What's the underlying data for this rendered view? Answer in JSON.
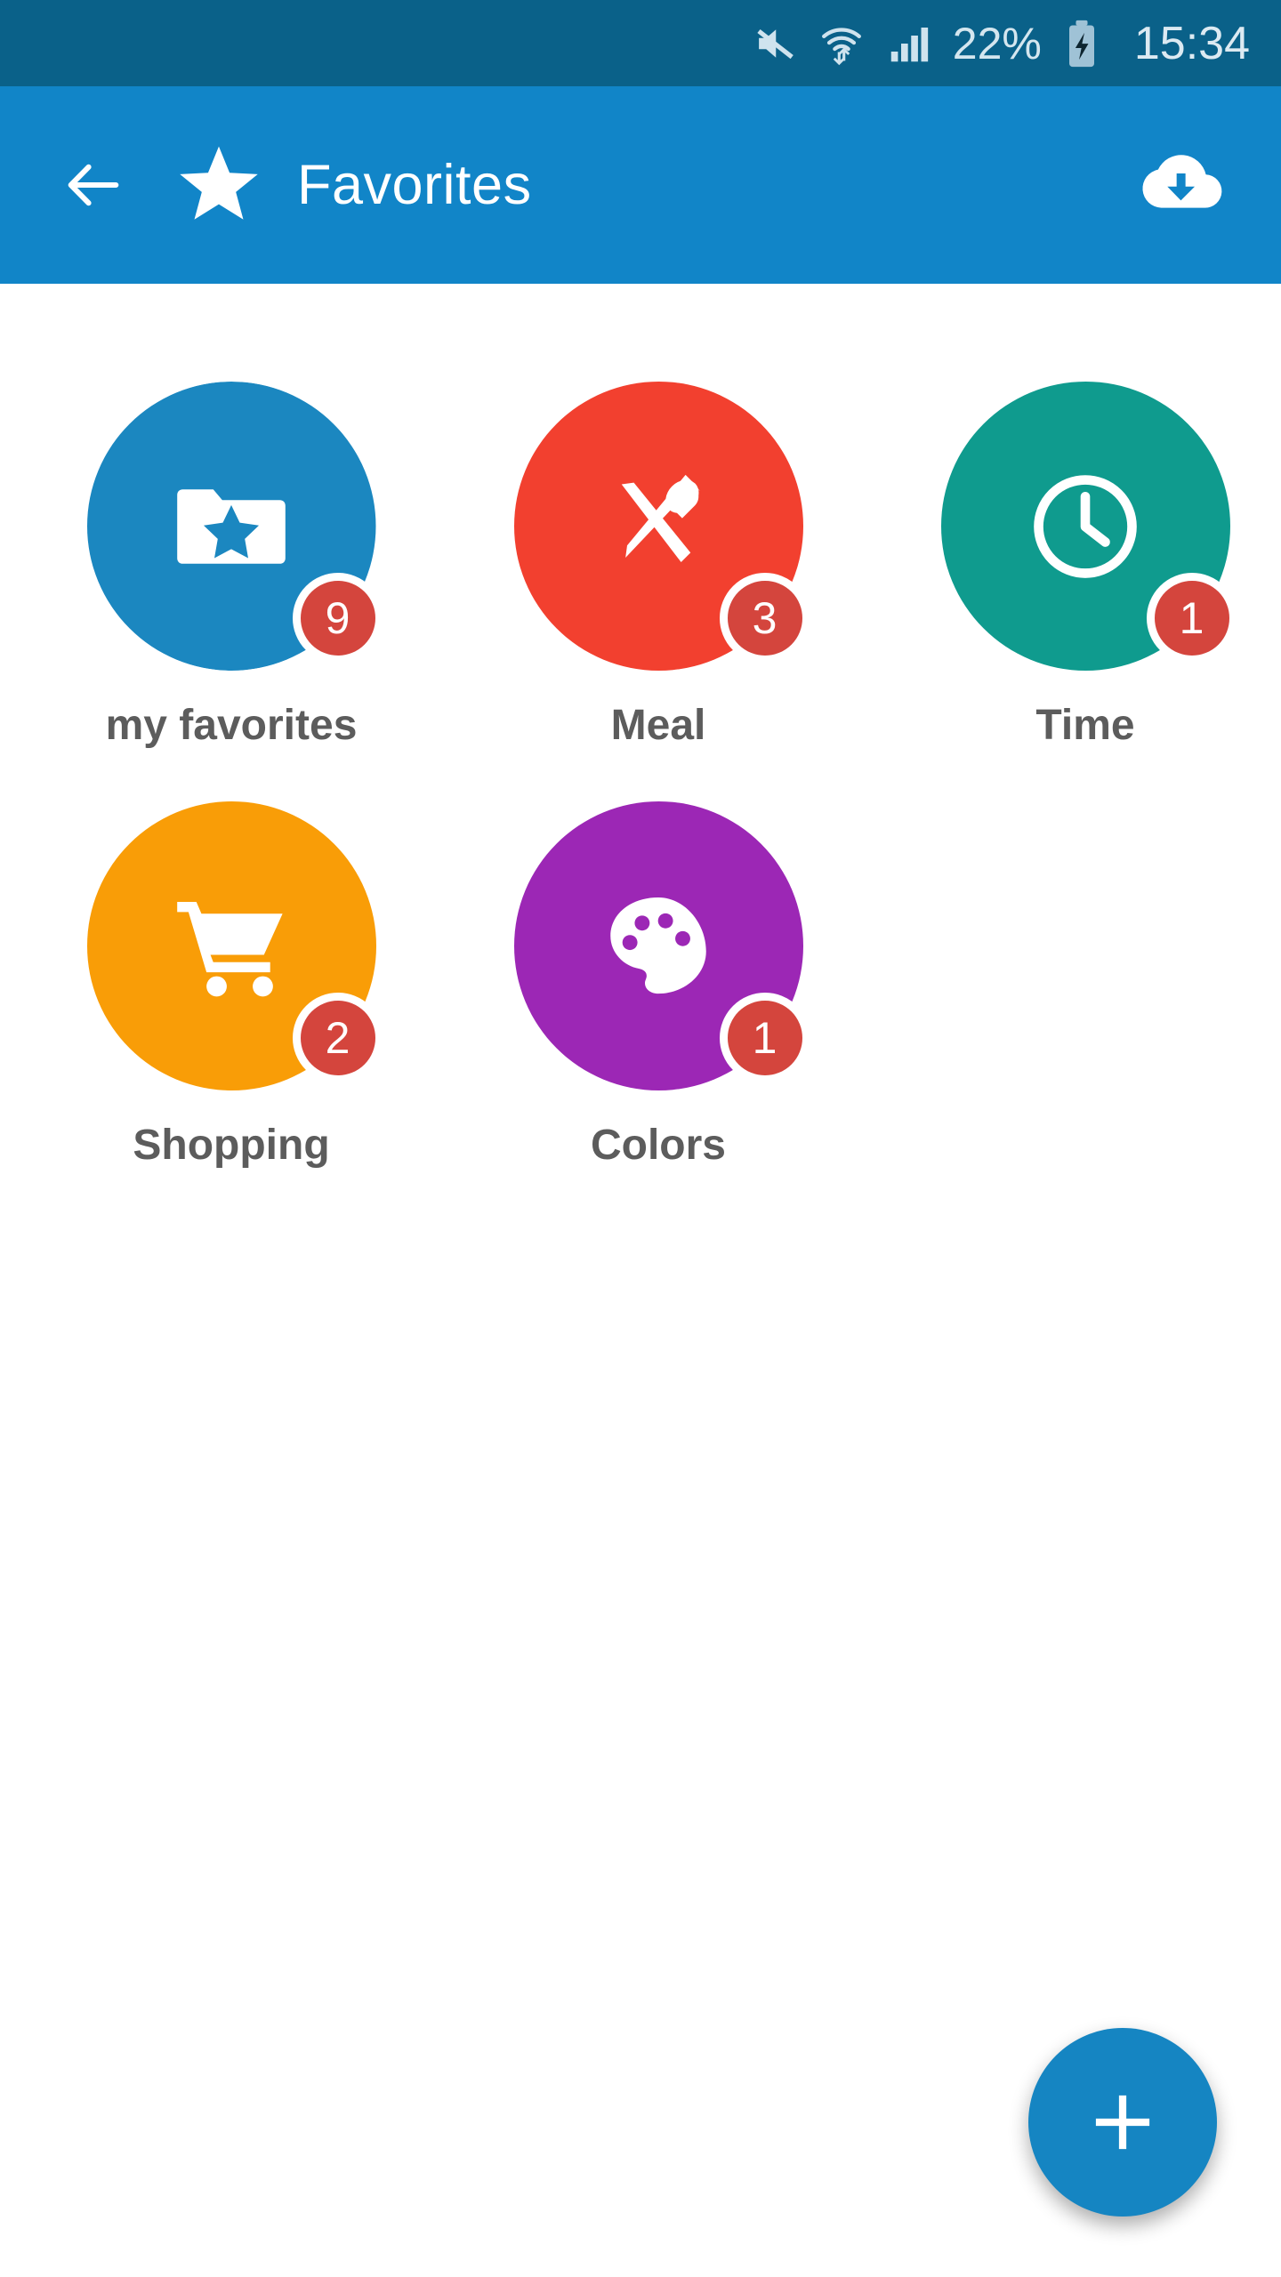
{
  "status_bar": {
    "background": "#0a6189",
    "battery_percent": "22%",
    "time": "15:34",
    "icons": [
      "volume-mute-icon",
      "wifi-transfer-icon",
      "cellular-signal-icon",
      "battery-charging-icon"
    ]
  },
  "app_bar": {
    "background": "#1185c8",
    "title": "Favorites",
    "back_icon": "arrow-left-icon",
    "leading_icon": "star-icon",
    "action_icon": "cloud-download-icon"
  },
  "grid": {
    "items": [
      {
        "label": "my favorites",
        "badge": "9",
        "color": "#1b87c0",
        "icon": "folder-star-icon"
      },
      {
        "label": "Meal",
        "badge": "3",
        "color": "#f2402f",
        "icon": "cutlery-icon"
      },
      {
        "label": "Time",
        "badge": "1",
        "color": "#0f9b8e",
        "icon": "clock-icon"
      },
      {
        "label": "Shopping",
        "badge": "2",
        "color": "#f99d07",
        "icon": "shopping-cart-icon"
      },
      {
        "label": "Colors",
        "badge": "1",
        "color": "#9c27b5",
        "icon": "paint-palette-icon"
      }
    ],
    "badge_color": "#d4453d",
    "label_color": "#5c5c5c"
  },
  "fab": {
    "icon": "plus-icon",
    "color": "#1585c2",
    "label": "+"
  }
}
